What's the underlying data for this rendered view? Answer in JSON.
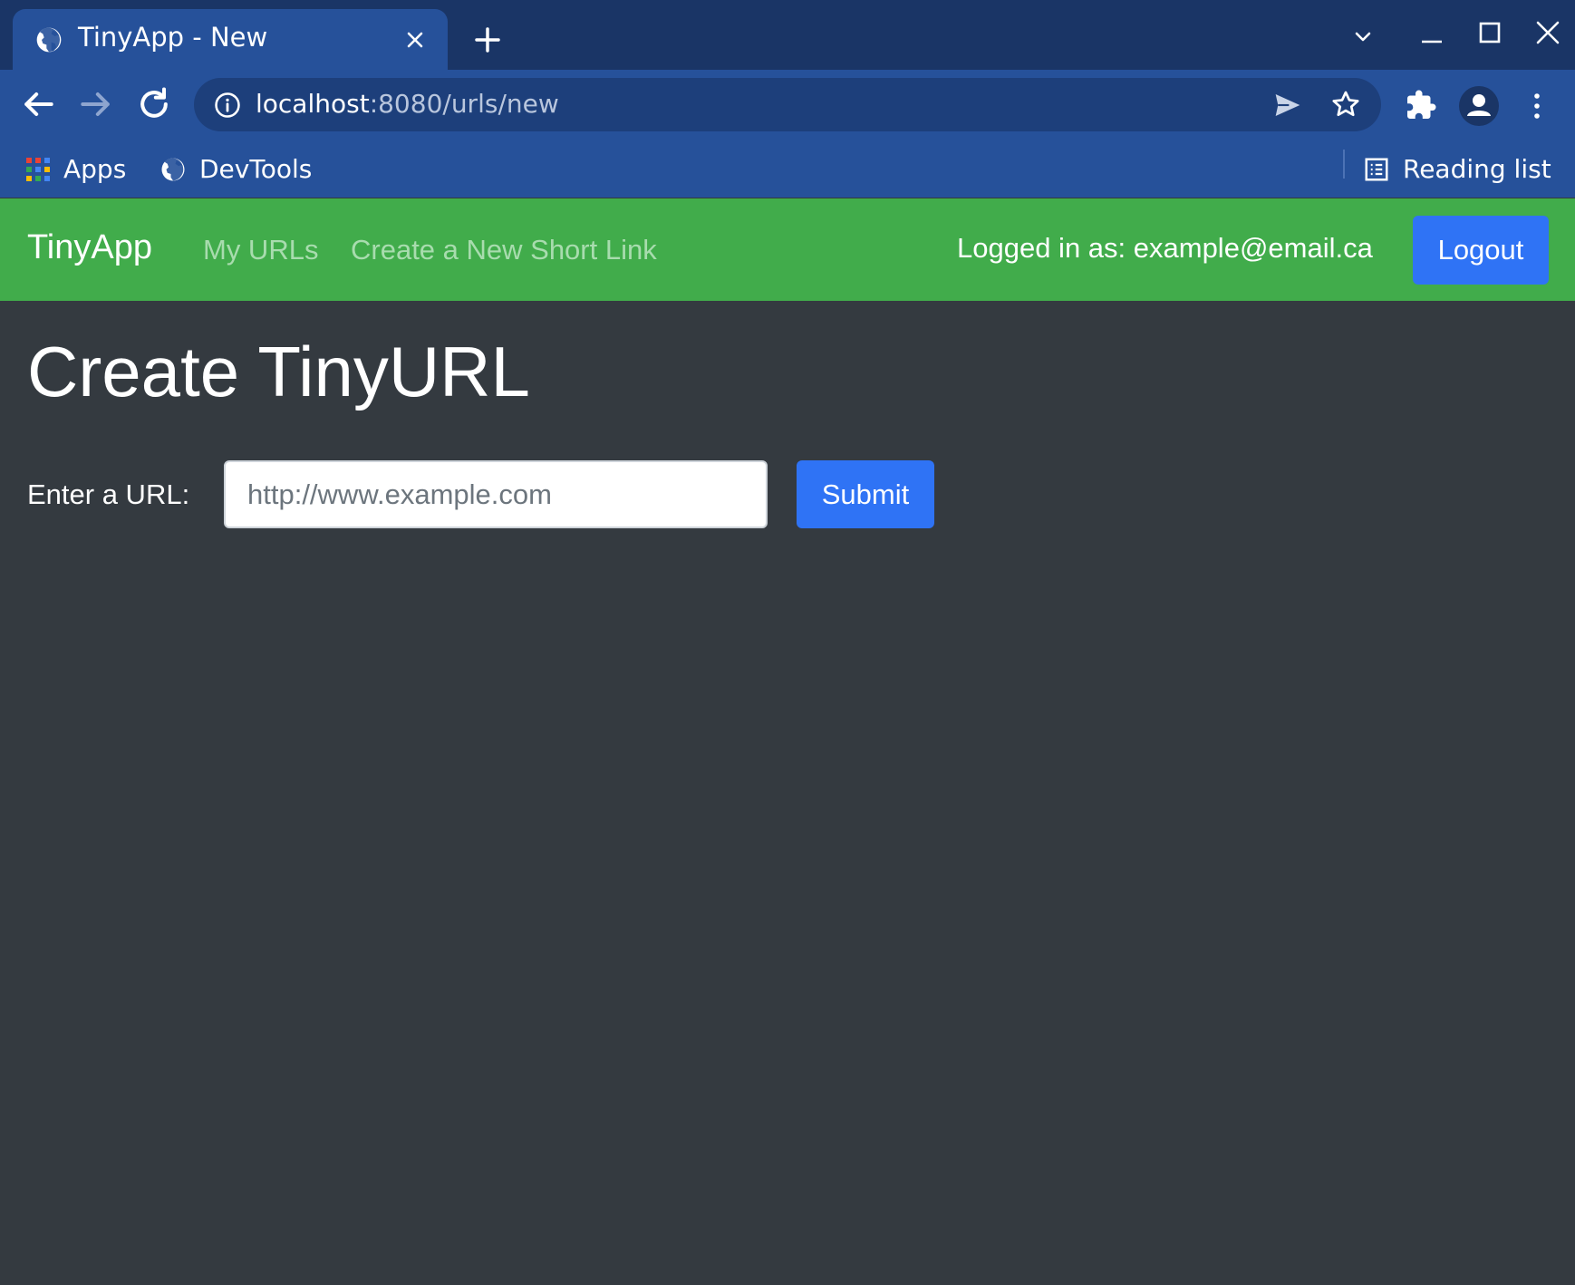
{
  "browser": {
    "tab": {
      "title": "TinyApp - New",
      "icon": "globe-icon"
    },
    "address": {
      "host": "localhost",
      "rest": ":8080/urls/new"
    },
    "bookmarks": [
      {
        "label": "Apps",
        "icon": "apps-grid-icon"
      },
      {
        "label": "DevTools",
        "icon": "globe-icon"
      }
    ],
    "reading_list": {
      "label": "Reading list",
      "icon": "reading-list-icon"
    }
  },
  "navbar": {
    "brand": "TinyApp",
    "links": [
      {
        "label": "My URLs"
      },
      {
        "label": "Create a New Short Link"
      }
    ],
    "logged_in": "Logged in as: example@email.ca",
    "logout_label": "Logout"
  },
  "main": {
    "title": "Create TinyURL",
    "form": {
      "label": "Enter a URL:",
      "placeholder": "http://www.example.com",
      "value": "",
      "submit_label": "Submit"
    }
  },
  "colors": {
    "titlebar": "#1a3566",
    "toolbar": "#26519a",
    "navbar": "#41ac4b",
    "page_bg": "#343a40",
    "primary_button": "#2f73f5",
    "nav_link": "#a8dcae"
  }
}
